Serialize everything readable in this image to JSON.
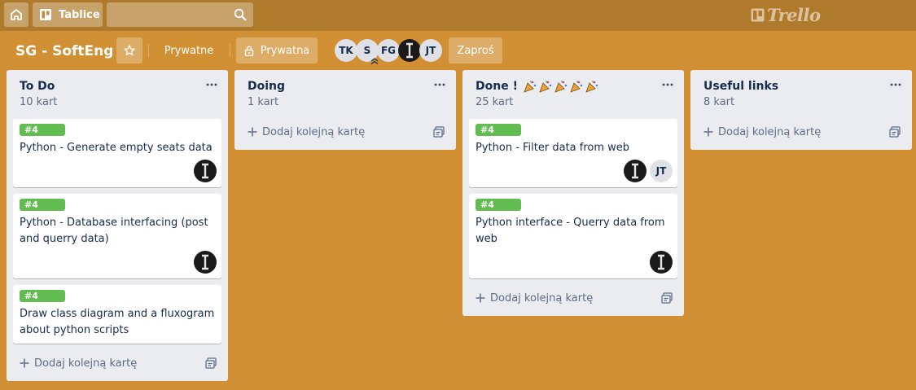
{
  "header": {
    "home_icon": "home-icon",
    "boards_label": "Tablice",
    "search_placeholder": "",
    "logo_text": "Trello"
  },
  "board": {
    "title": "SG - SoftEng",
    "team_label": "Prywatne",
    "visibility_label": "Prywatna",
    "invite_label": "Zaproś",
    "members": [
      "TK",
      "S",
      "FG",
      "",
      "JT"
    ]
  },
  "lists": [
    {
      "title": "To Do",
      "count": "10 kart",
      "cards": [
        {
          "label": "#4",
          "title": "Python - Generate empty seats data"
        },
        {
          "label": "#4",
          "title": "Python - Database interfacing (post and querry data)"
        },
        {
          "label": "#4",
          "title": "Draw class diagram and a fluxogram about python scripts"
        }
      ],
      "add_label": "Dodaj kolejną kartę"
    },
    {
      "title": "Doing",
      "count": "1 kart",
      "cards": [],
      "add_label": "Dodaj kolejną kartę"
    },
    {
      "title": "Done !",
      "count": "25 kart",
      "cards": [
        {
          "label": "#4",
          "title": "Python - Filter data from web",
          "member": "JT"
        },
        {
          "label": "#4",
          "title": "Python interface - Querry data from web"
        }
      ],
      "add_label": "Dodaj kolejną kartę"
    },
    {
      "title": "Useful links",
      "count": "8 kart",
      "cards": [],
      "add_label": "Dodaj kolejną kartę"
    }
  ],
  "colors": {
    "board_bg": "#d29034",
    "header_bg": "#b07a2c",
    "label_green": "#61bd4f",
    "list_bg": "#ebecf0"
  }
}
